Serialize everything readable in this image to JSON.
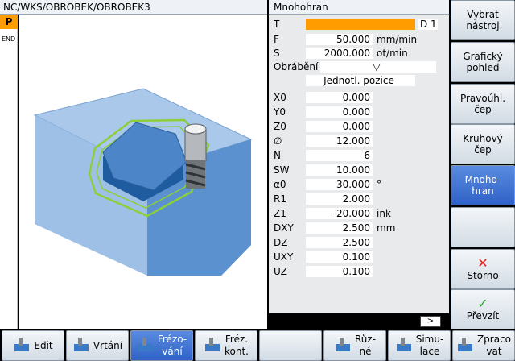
{
  "header": {
    "path": "NC/WKS/OBROBEK/OBROBEK3",
    "panel_title": "Mnohohran"
  },
  "program": {
    "p": "P",
    "end": "END"
  },
  "params": {
    "T": {
      "label": "T",
      "value": "",
      "extra": "D 1"
    },
    "F": {
      "label": "F",
      "value": "50.000",
      "unit": "mm/min"
    },
    "S": {
      "label": "S",
      "value": "2000.000",
      "unit": "ot/min"
    },
    "obrabeni": {
      "label": "Obrábění",
      "value": "▽"
    },
    "position_mode": "Jednotl. pozice",
    "rows": [
      {
        "label": "X0",
        "value": "0.000",
        "unit": ""
      },
      {
        "label": "Y0",
        "value": "0.000",
        "unit": ""
      },
      {
        "label": "Z0",
        "value": "0.000",
        "unit": ""
      },
      {
        "label": "∅",
        "value": "12.000",
        "unit": ""
      },
      {
        "label": "N",
        "value": "6",
        "unit": ""
      },
      {
        "label": "SW",
        "value": "10.000",
        "unit": ""
      },
      {
        "label": "α0",
        "value": "30.000",
        "unit": "°"
      },
      {
        "label": "R1",
        "value": "2.000",
        "unit": ""
      },
      {
        "label": "Z1",
        "value": "-20.000",
        "unit": "ink"
      },
      {
        "label": "DXY",
        "value": "2.500",
        "unit": "mm"
      },
      {
        "label": "DZ",
        "value": "2.500",
        "unit": ""
      },
      {
        "label": "UXY",
        "value": "0.100",
        "unit": ""
      },
      {
        "label": "UZ",
        "value": "0.100",
        "unit": ""
      }
    ],
    "scroll": ">"
  },
  "vsoft": [
    {
      "l1": "Vybrat",
      "l2": "nástroj"
    },
    {
      "l1": "Grafický",
      "l2": "pohled"
    },
    {
      "l1": "Pravoúhl.",
      "l2": "čep"
    },
    {
      "l1": "Kruhový",
      "l2": "čep"
    },
    {
      "l1": "Mnoho-",
      "l2": "hran"
    },
    {
      "l1": "",
      "l2": ""
    },
    {
      "l1": "✕",
      "l2": "Storno"
    },
    {
      "l1": "✓",
      "l2": "Převzít"
    }
  ],
  "hsoft": [
    {
      "l1": "Edit",
      "l2": ""
    },
    {
      "l1": "Vrtání",
      "l2": ""
    },
    {
      "l1": "Frézo-",
      "l2": "vání"
    },
    {
      "l1": "Fréz.",
      "l2": "kont."
    },
    {
      "l1": "",
      "l2": ""
    },
    {
      "l1": "Růz-",
      "l2": "né"
    },
    {
      "l1": "Simu-",
      "l2": "lace"
    },
    {
      "l1": "Zpraco",
      "l2": "vat"
    }
  ],
  "colors": {
    "accent_orange": "#ff9c00",
    "active_blue": "#3a6ed6",
    "path_green": "#8ccf3a",
    "block_top": "#a9c8ea",
    "block_side": "#6aa0d8"
  }
}
